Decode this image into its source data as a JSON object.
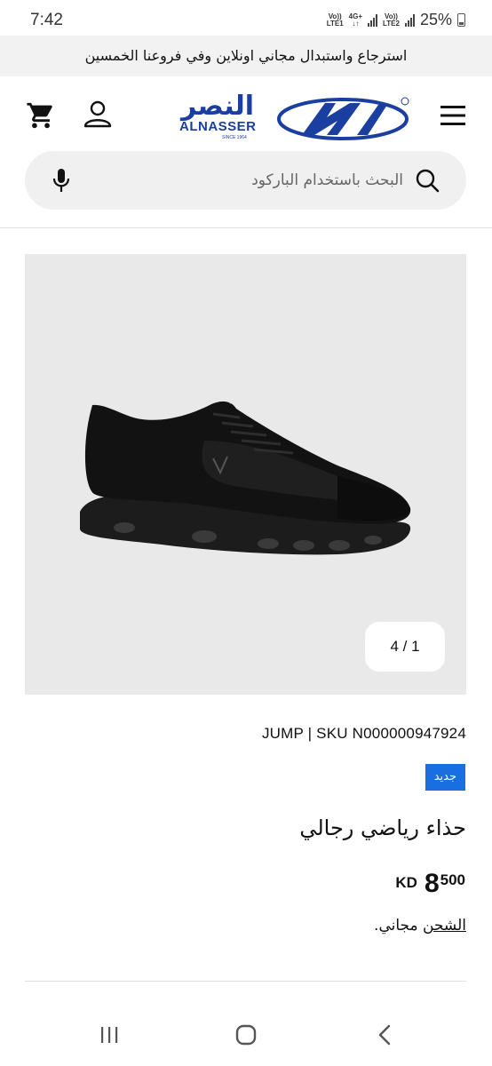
{
  "status_bar": {
    "time": "7:42",
    "sim1_label_top": "Vo))",
    "sim1_label_bottom": "LTE1",
    "net_top": "4G+",
    "sim2_label_top": "Vo))",
    "sim2_label_bottom": "LTE2",
    "battery": "25%"
  },
  "promo": {
    "text": "استرجاع واستبدال مجاني اونلاين وفي فروعنا الخمسين"
  },
  "header": {
    "logo_ar": "النصر",
    "logo_en": "ALNASSER",
    "logo_since": "SINCE 1964"
  },
  "search": {
    "placeholder": "البحث باستخدام الباركود"
  },
  "gallery": {
    "pager": "4 / 1"
  },
  "product": {
    "brand_sku": "JUMP  |  SKU N000000947924",
    "badge": "جديد",
    "title": "حذاء رياضي رجالي",
    "currency": "KD",
    "price_main": "8",
    "price_decimal": "500",
    "shipping_link": "الشحن",
    "shipping_rest": " مجاني."
  },
  "colors": {
    "brand_blue": "#1b3fa0",
    "badge_blue": "#1a6fe0",
    "image_bg": "#e9e9e9"
  },
  "icons": [
    "menu-icon",
    "account-icon",
    "cart-icon",
    "search-icon",
    "mic-icon",
    "recent-apps-icon",
    "home-icon",
    "back-icon"
  ]
}
